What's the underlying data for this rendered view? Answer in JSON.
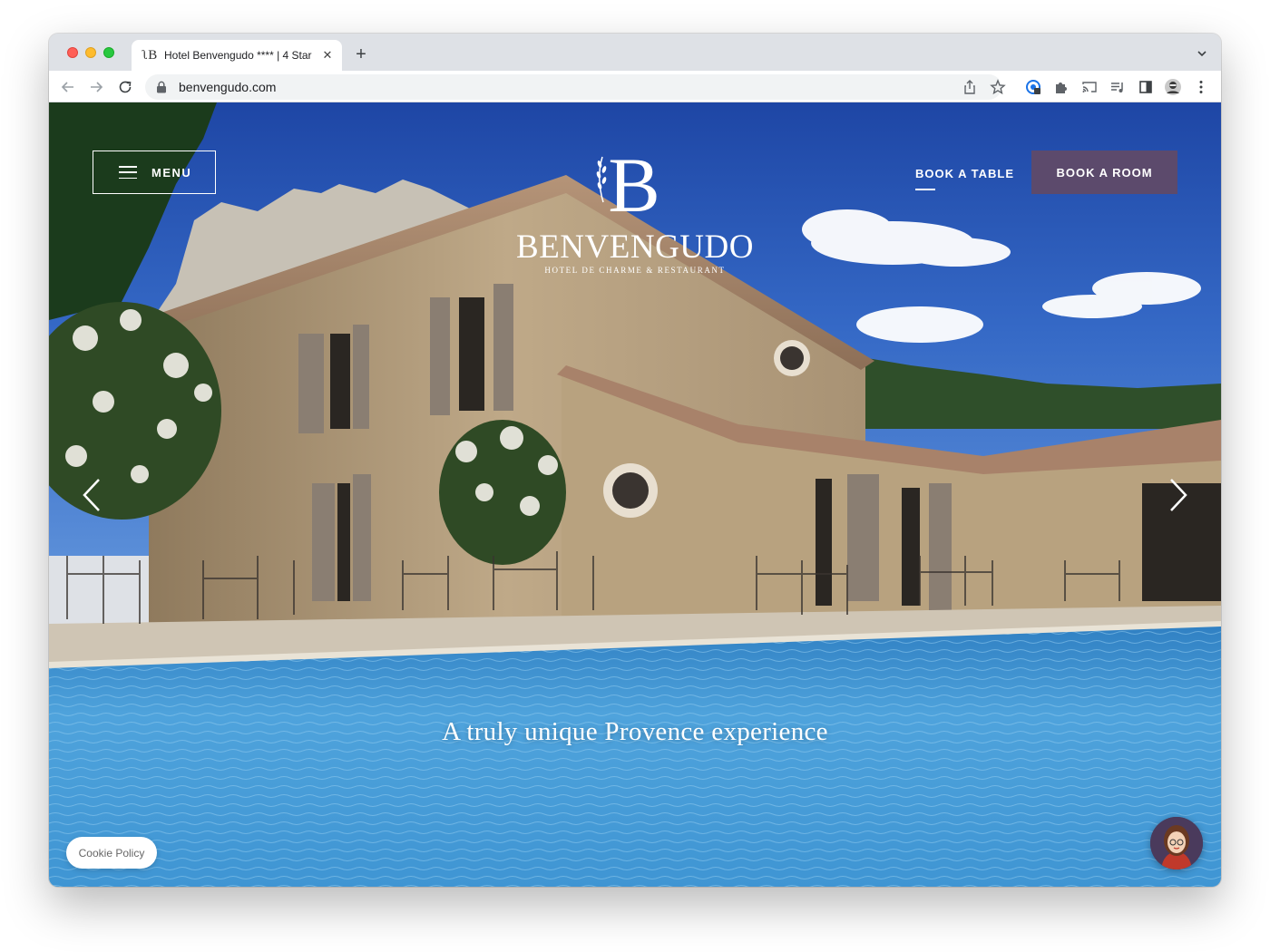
{
  "browser": {
    "tab_title": "Hotel Benvengudo **** | 4 Star",
    "tab_favicon": "ʅB",
    "new_tab": "+",
    "close": "✕",
    "url": "benvengudo.com",
    "icons": [
      "back-icon",
      "forward-icon",
      "reload-icon",
      "lock-icon",
      "share-icon",
      "star-icon",
      "extension-icon",
      "puzzle-icon",
      "cast-icon",
      "media-icon",
      "sidebar-icon",
      "profile-icon",
      "kebab-menu-icon"
    ]
  },
  "site": {
    "menu_label": "MENU",
    "logo_name": "BENVENGUDO",
    "logo_tagline": "HOTEL DE CHARME & RESTAURANT",
    "book_table": "BOOK A TABLE",
    "book_room": "BOOK A ROOM",
    "tagline": "A truly unique Provence experience",
    "cookie": "Cookie Policy",
    "accent_color": "#5c4a6c"
  }
}
